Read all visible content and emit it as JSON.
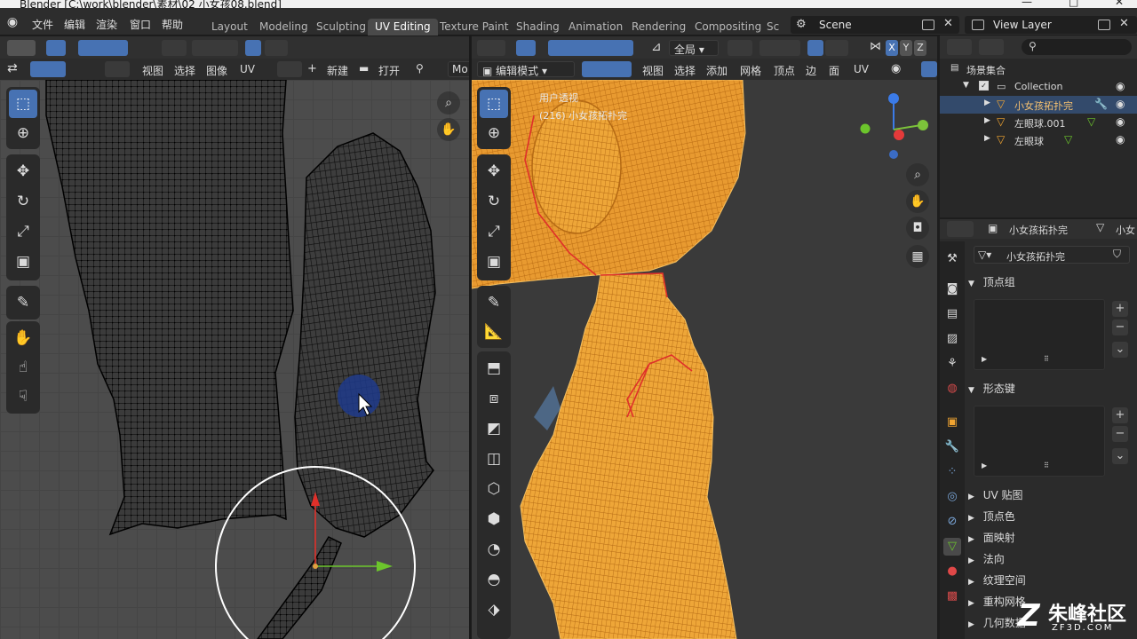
{
  "window": {
    "title": "Blender [C:\\work\\blender\\素材\\02 小女孩08.blend]"
  },
  "menu": [
    "文件",
    "编辑",
    "渲染",
    "窗口",
    "帮助"
  ],
  "workspaces": [
    {
      "label": "Layout",
      "active": false
    },
    {
      "label": "Modeling",
      "active": false
    },
    {
      "label": "Sculpting",
      "active": false
    },
    {
      "label": "UV Editing",
      "active": true
    },
    {
      "label": "Texture Paint",
      "active": false
    },
    {
      "label": "Shading",
      "active": false
    },
    {
      "label": "Animation",
      "active": false
    },
    {
      "label": "Rendering",
      "active": false
    },
    {
      "label": "Compositing",
      "active": false
    },
    {
      "label": "Sc",
      "active": false
    }
  ],
  "scene": "Scene",
  "view_layer": "View Layer",
  "uv_editor": {
    "header_menus": [
      "视图",
      "选择",
      "图像",
      "UV"
    ],
    "new_label": "新建",
    "open_label": "打开",
    "mode_label": "Mo"
  },
  "viewport": {
    "pivot_label": "全局",
    "axes": [
      "X",
      "Y",
      "Z"
    ],
    "mode": "编辑模式",
    "menus": [
      "视图",
      "选择",
      "添加",
      "网格",
      "顶点",
      "边",
      "面",
      "UV"
    ],
    "overlay_line1": "用户透视",
    "overlay_line2": "(216) 小女孩拓扑完"
  },
  "outliner": {
    "root": "场景集合",
    "collection": "Collection",
    "objects": [
      "小女孩拓扑完",
      "左眼球.001",
      "左眼球"
    ]
  },
  "properties": {
    "object_name": "小女孩拓扑完",
    "object_name_short": "小女",
    "mesh_name": "小女孩拓扑完",
    "sections_open": [
      "顶点组",
      "形态键"
    ],
    "sections_closed": [
      "UV 贴图",
      "顶点色",
      "面映射",
      "法向",
      "纹理空间",
      "重构网格",
      "几何数据"
    ]
  },
  "watermark": {
    "text": "朱峰社区",
    "url": "ZF3D.COM"
  },
  "colors": {
    "accent": "#4772b3",
    "mesh_orange": "#f2a531",
    "seam_red": "#e0302a"
  }
}
